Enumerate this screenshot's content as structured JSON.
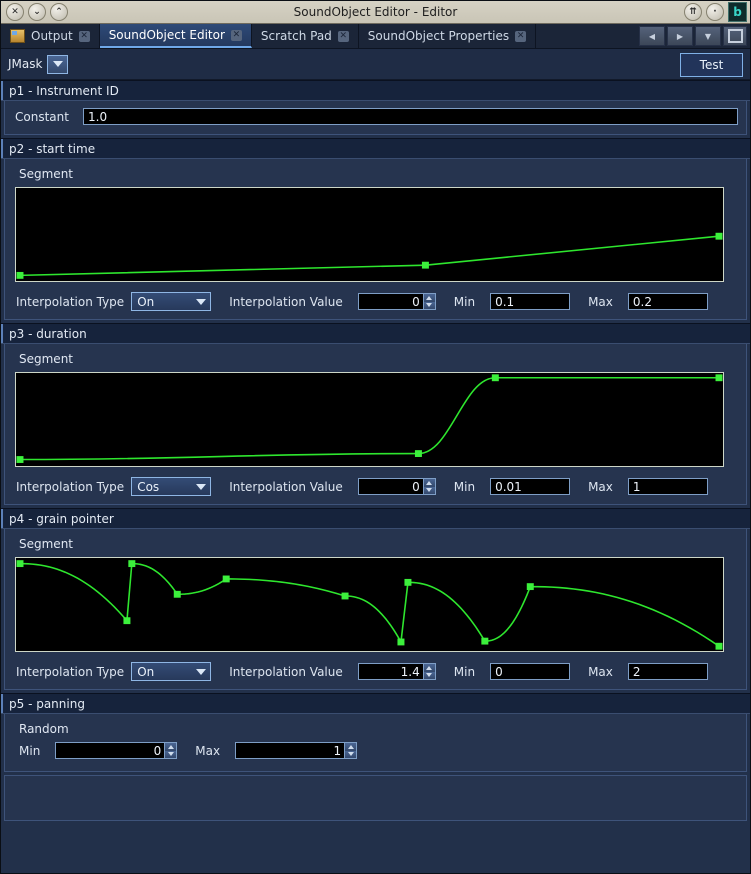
{
  "window": {
    "title": "SoundObject Editor - Editor",
    "left_buttons": [
      {
        "name": "close-window-button",
        "glyph": "✕"
      },
      {
        "name": "minimize-window-button",
        "glyph": "⌄"
      },
      {
        "name": "maximize-window-button",
        "glyph": "⌃"
      }
    ],
    "right_buttons": [
      {
        "name": "shade-window-button",
        "glyph": "⇈"
      },
      {
        "name": "iconify-window-button",
        "glyph": "·"
      }
    ],
    "badge": "b"
  },
  "tabs": [
    {
      "label": "Output",
      "active": false,
      "has_icon": true,
      "close": "✕"
    },
    {
      "label": "SoundObject Editor",
      "active": true,
      "has_icon": false,
      "close": "✕"
    },
    {
      "label": "Scratch Pad",
      "active": false,
      "has_icon": false,
      "close": "✕"
    },
    {
      "label": "SoundObject Properties",
      "active": false,
      "has_icon": false,
      "close": "✕"
    }
  ],
  "tabbar_nav": {
    "prev": "◀",
    "next": "▶",
    "dropdown": "▼",
    "maximize": "☐"
  },
  "toolbar": {
    "type_label": "JMask",
    "type_dropdown_glyph": "▼",
    "test_label": "Test"
  },
  "panels": [
    {
      "id": "p1",
      "header": "p1 - Instrument ID",
      "kind": "constant",
      "constant_label": "Constant",
      "constant_value": "1.0"
    },
    {
      "id": "p2",
      "header": "p2 - start time",
      "kind": "segment",
      "segment_label": "Segment",
      "interp_type_label": "Interpolation Type",
      "interp_type_value": "On",
      "interp_value_label": "Interpolation Value",
      "interp_value": "0",
      "min_label": "Min",
      "min_value": "0.1",
      "max_label": "Max",
      "max_value": "0.2"
    },
    {
      "id": "p3",
      "header": "p3 - duration",
      "kind": "segment",
      "segment_label": "Segment",
      "interp_type_label": "Interpolation Type",
      "interp_type_value": "Cos",
      "interp_value_label": "Interpolation Value",
      "interp_value": "0",
      "min_label": "Min",
      "min_value": "0.01",
      "max_label": "Max",
      "max_value": "1"
    },
    {
      "id": "p4",
      "header": "p4 - grain pointer",
      "kind": "segment",
      "segment_label": "Segment",
      "interp_type_label": "Interpolation Type",
      "interp_type_value": "On",
      "interp_value_label": "Interpolation Value",
      "interp_value": "1.4",
      "min_label": "Min",
      "min_value": "0",
      "max_label": "Max",
      "max_value": "2"
    },
    {
      "id": "p5",
      "header": "p5 - panning",
      "kind": "random",
      "random_label": "Random",
      "min_label": "Min",
      "min_value": "0",
      "max_label": "Max",
      "max_value": "1"
    }
  ],
  "colors": {
    "curve": "#2ee62e",
    "handle": "#3cf03c",
    "graph_bg": "#000000",
    "graph_border": "#cdd6c7",
    "panel_bg": "#26344f",
    "panel_header_bg": "#16233c",
    "accent": "#6fa8e8"
  },
  "chart_data": [
    {
      "id": "p2-start-time-envelope",
      "type": "line",
      "title": "p2 - start time",
      "xlabel": "",
      "ylabel": "",
      "xlim": [
        0,
        1
      ],
      "ylim": [
        0,
        1
      ],
      "grid": false,
      "interpolation": "On",
      "interpolation_value": 0,
      "min": 0.1,
      "max": 0.2,
      "points": [
        {
          "x": 0.0,
          "y": 0.02
        },
        {
          "x": 0.58,
          "y": 0.14
        },
        {
          "x": 1.0,
          "y": 0.48
        }
      ]
    },
    {
      "id": "p3-duration-envelope",
      "type": "line",
      "title": "p3 - duration",
      "xlabel": "",
      "ylabel": "",
      "xlim": [
        0,
        1
      ],
      "ylim": [
        0,
        1
      ],
      "grid": false,
      "interpolation": "Cos",
      "interpolation_value": 0,
      "min": 0.01,
      "max": 1,
      "points": [
        {
          "x": 0.0,
          "y": 0.03
        },
        {
          "x": 0.57,
          "y": 0.1
        },
        {
          "x": 0.68,
          "y": 0.99
        },
        {
          "x": 1.0,
          "y": 0.99
        }
      ]
    },
    {
      "id": "p4-grain-pointer-envelope",
      "type": "line",
      "title": "p4 - grain pointer",
      "xlabel": "",
      "ylabel": "",
      "xlim": [
        0,
        1
      ],
      "ylim": [
        0,
        1
      ],
      "grid": false,
      "interpolation": "On",
      "interpolation_value": 1.4,
      "min": 0,
      "max": 2,
      "points": [
        {
          "x": 0.0,
          "y": 0.98
        },
        {
          "x": 0.153,
          "y": 0.31
        },
        {
          "x": 0.16,
          "y": 0.98
        },
        {
          "x": 0.225,
          "y": 0.62
        },
        {
          "x": 0.295,
          "y": 0.8
        },
        {
          "x": 0.465,
          "y": 0.6
        },
        {
          "x": 0.545,
          "y": 0.06
        },
        {
          "x": 0.555,
          "y": 0.76
        },
        {
          "x": 0.665,
          "y": 0.07
        },
        {
          "x": 0.73,
          "y": 0.71
        },
        {
          "x": 1.0,
          "y": 0.01
        }
      ]
    }
  ]
}
